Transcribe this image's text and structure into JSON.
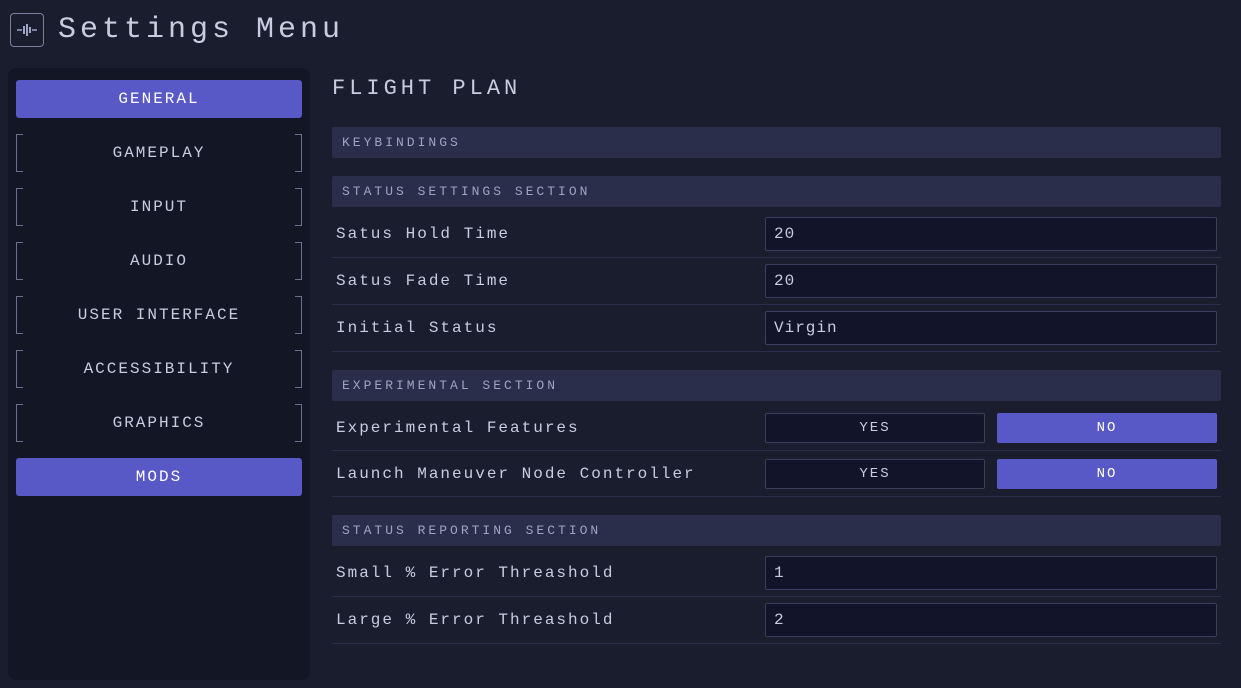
{
  "header": {
    "title": "Settings Menu"
  },
  "sidebar": {
    "items": [
      {
        "label": "GENERAL",
        "active": true,
        "bracketed": false
      },
      {
        "label": "GAMEPLAY",
        "active": false,
        "bracketed": true
      },
      {
        "label": "INPUT",
        "active": false,
        "bracketed": true
      },
      {
        "label": "AUDIO",
        "active": false,
        "bracketed": true
      },
      {
        "label": "USER INTERFACE",
        "active": false,
        "bracketed": true
      },
      {
        "label": "ACCESSIBILITY",
        "active": false,
        "bracketed": true
      },
      {
        "label": "GRAPHICS",
        "active": false,
        "bracketed": true
      },
      {
        "label": "MODS",
        "active": true,
        "bracketed": false
      }
    ]
  },
  "main": {
    "title": "FLIGHT PLAN",
    "sections": {
      "keybindings": {
        "header": "KEYBINDINGS"
      },
      "status": {
        "header": "STATUS SETTINGS SECTION",
        "holdTime": {
          "label": "Satus Hold Time",
          "value": "20"
        },
        "fadeTime": {
          "label": "Satus Fade Time",
          "value": "20"
        },
        "initStatus": {
          "label": "Initial Status",
          "value": "Virgin"
        }
      },
      "experimental": {
        "header": "EXPERIMENTAL SECTION",
        "features": {
          "label": "Experimental Features",
          "yes": "YES",
          "no": "NO",
          "selected": "no"
        },
        "launch": {
          "label": "Launch Maneuver Node Controller",
          "yes": "YES",
          "no": "NO",
          "selected": "no"
        }
      },
      "reporting": {
        "header": "STATUS REPORTING SECTION",
        "smallErr": {
          "label": "Small % Error Threashold",
          "value": "1"
        },
        "largeErr": {
          "label": "Large % Error Threashold",
          "value": "2"
        }
      }
    }
  }
}
